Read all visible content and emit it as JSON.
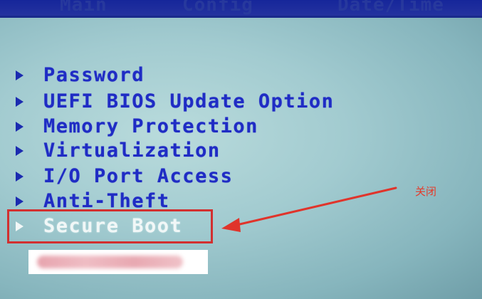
{
  "header": {
    "tabs": [
      {
        "label": "Main"
      },
      {
        "label": "Config"
      },
      {
        "label": "Date/Time"
      }
    ]
  },
  "menu": {
    "items": [
      {
        "label": "Password",
        "selected": false
      },
      {
        "label": "UEFI BIOS Update Option",
        "selected": false
      },
      {
        "label": "Memory Protection",
        "selected": false
      },
      {
        "label": "Virtualization",
        "selected": false
      },
      {
        "label": "I/O Port Access",
        "selected": false
      },
      {
        "label": "Anti-Theft",
        "selected": false
      },
      {
        "label": "Secure Boot",
        "selected": true
      }
    ]
  },
  "annotation": {
    "text": "关闭"
  },
  "colors": {
    "menu_text": "#1f2cc4",
    "selected_text": "#f1f7f7",
    "highlight_box": "#d23030",
    "annotation": "#e43a2a"
  }
}
